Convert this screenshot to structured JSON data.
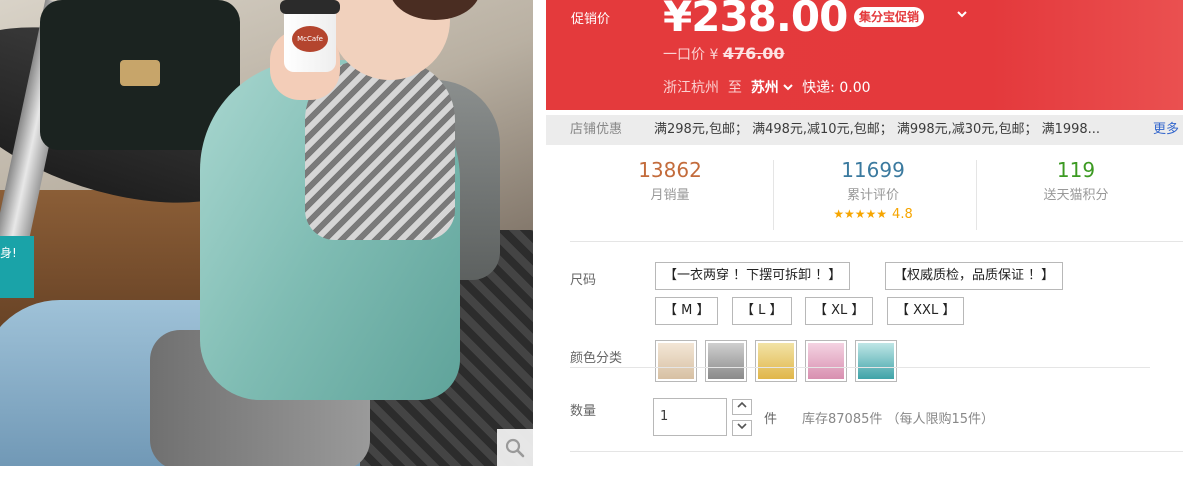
{
  "image": {
    "cup_text": "McCafe",
    "tag_text": "身!"
  },
  "price": {
    "label": "促销价",
    "amount": "¥238.00",
    "badge": "集分宝促销",
    "orig_label": "一口价 ¥",
    "orig_value": "476.00"
  },
  "shipping": {
    "from": "浙江杭州",
    "to_word": "至",
    "to_city": "苏州",
    "express": "快递: 0.00"
  },
  "shop_promo": {
    "label": "店铺优惠",
    "text": "满298元,包邮； 满498元,减10元,包邮； 满998元,减30元,包邮； 满1998...",
    "more": "更多"
  },
  "stats": [
    {
      "value": "13862",
      "caption": "月销量"
    },
    {
      "value": "11699",
      "caption": "累计评价",
      "stars": "★★★★★",
      "score": "4.8"
    },
    {
      "value": "119",
      "caption": "送天猫积分"
    }
  ],
  "size": {
    "label": "尺码",
    "options": [
      "【一衣两穿 ！下摆可拆卸 ！】",
      "【权威质检，品质保证 ！】",
      "【 M 】",
      "【 L 】",
      "【 XL 】",
      "【 XXL 】"
    ]
  },
  "color": {
    "label": "颜色分类",
    "swatches": [
      "#d7c0a3",
      "#8a8a8a",
      "#e0b64a",
      "#d88fb0",
      "#3fa3a8"
    ]
  },
  "quantity": {
    "label": "数量",
    "value": "1",
    "unit": "件",
    "stock": "库存87085件 （每人限购15件）"
  }
}
